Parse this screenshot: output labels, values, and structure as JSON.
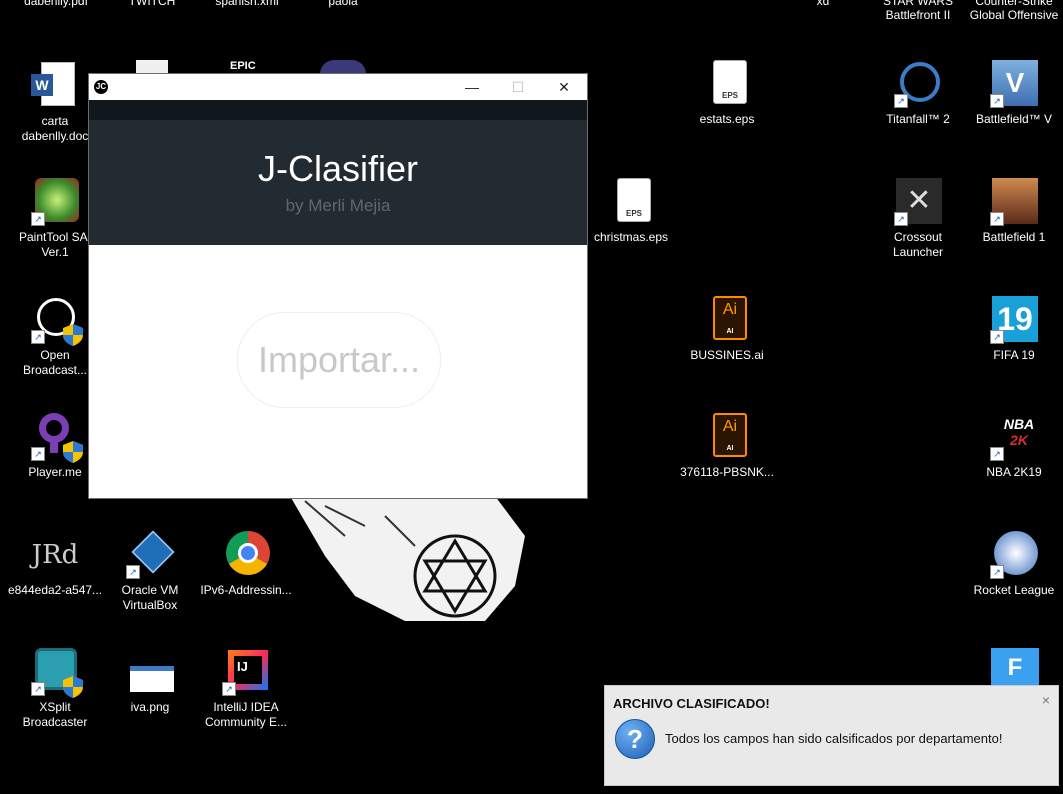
{
  "desktop": {
    "top_labels": [
      "dabenlly.pdf",
      "TWITCH",
      "spanish.xml",
      "paola",
      "xd",
      "STAR WARS\nBattlefront II",
      "Counter-Strike\nGlobal Offensive"
    ],
    "icons": {
      "carta": "carta\ndabenlly.doc",
      "painttool": "PaintTool SAI\nVer.1",
      "obs": "Open\nBroadcast...",
      "playerme": "Player.me",
      "e844": "e844eda2-a547...",
      "xsplit": "XSplit\nBroadcaster",
      "virtualbox": "Oracle VM\nVirtualBox",
      "iva": "iva.png",
      "chrome": "IPv6-Addressin...",
      "intellij": "IntelliJ IDEA\nCommunity E...",
      "christmas": "christmas.eps",
      "estats": "estats.eps",
      "bussines": "BUSSINES.ai",
      "pbsnk": "376118-PBSNK...",
      "titanfall": "Titanfall™ 2",
      "battlefieldv": "Battlefield™ V",
      "crossout": "Crossout\nLauncher",
      "battlefield1": "Battlefield 1",
      "fifa": "FIFA 19",
      "nba": "NBA 2K19",
      "rocket": "Rocket League"
    },
    "file_badges": {
      "eps": "EPS",
      "ai": "Ai",
      "ai_small": "AI",
      "word": "W",
      "fifa": "19",
      "nba": "NBA",
      "nba2k": "2K"
    }
  },
  "window": {
    "app_icon": "JC",
    "title": "J-Clasifier",
    "subtitle": "by Merli Mejia",
    "import_button": "Importar...",
    "controls": {
      "minimize": "—",
      "maximize": "☐",
      "close": "✕"
    }
  },
  "notification": {
    "title": "ARCHIVO CLASIFICADO!",
    "message": "Todos los campos han sido calsificados por departamento!",
    "icon": "?",
    "close": "×"
  },
  "colors": {
    "header": "#222b31",
    "header_top": "#11181d",
    "subtitle": "#5e6870",
    "desktop": "#000000"
  }
}
